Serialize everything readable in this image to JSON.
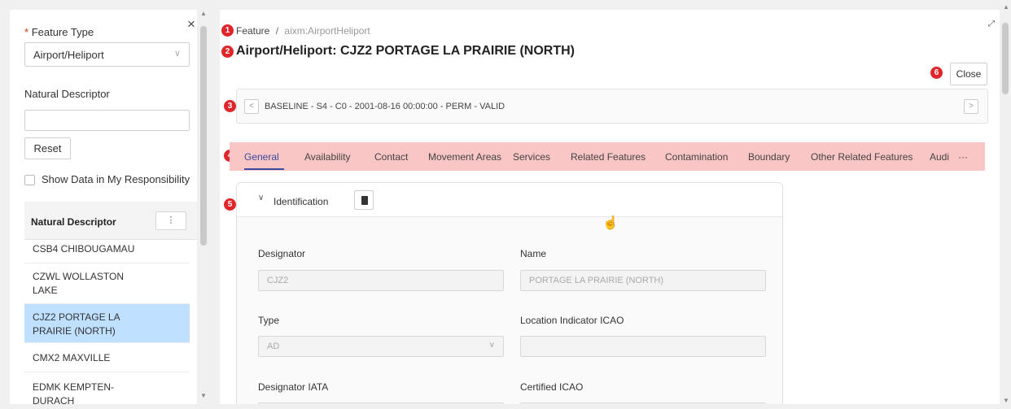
{
  "left": {
    "close_glyph": "×",
    "feature_type_label": "Feature Type",
    "required_mark": "*",
    "feature_type_value": "Airport/Heliport",
    "natural_descriptor_label": "Natural Descriptor",
    "natural_descriptor_value": "",
    "reset_label": "Reset",
    "show_data_label": "Show Data in My Responsibility",
    "list_header": "Natural Descriptor",
    "list_menu_glyph": "⋮",
    "items": [
      {
        "label_line1": "CSB4 CHIBOUGAMAU",
        "label_line2": ""
      },
      {
        "label_line1": "CZWL WOLLASTON",
        "label_line2": "LAKE"
      },
      {
        "label_line1": "CJZ2 PORTAGE LA",
        "label_line2": "PRAIRIE (NORTH)",
        "selected": true
      },
      {
        "label_line1": "CMX2 MAXVILLE",
        "label_line2": ""
      },
      {
        "label_line1": "EDMK KEMPTEN-",
        "label_line2": "DURACH"
      }
    ]
  },
  "main": {
    "badges": [
      "1",
      "2",
      "3",
      "4",
      "5",
      "6"
    ],
    "breadcrumb": {
      "root": "Feature",
      "separator": "/",
      "current": "aixm:AirportHeliport"
    },
    "title": "Airport/Heliport: CJZ2 PORTAGE LA PRAIRIE (NORTH)",
    "close_label": "Close",
    "version_text": "BASELINE - S4 - C0 - 2001-08-16 00:00:00 - PERM - VALID",
    "tabs": [
      "General",
      "Availability",
      "Contact",
      "Movement Areas",
      "Services",
      "Related Features",
      "Contamination",
      "Boundary",
      "Other Related Features",
      "Audi",
      "···"
    ],
    "section": {
      "title": "Identification",
      "fields": {
        "designator_label": "Designator",
        "designator_value": "CJZ2",
        "name_label": "Name",
        "name_value": "PORTAGE LA PRAIRIE (NORTH)",
        "type_label": "Type",
        "type_value": "AD",
        "location_indicator_label": "Location Indicator ICAO",
        "location_indicator_value": "",
        "designator_iata_label": "Designator IATA",
        "certified_icao_label": "Certified ICAO"
      }
    }
  },
  "colors": {
    "badge": "#e0262a",
    "tabs_highlight": "#f9c5c5",
    "selected_item": "#bfe0ff",
    "active_tab": "#3a4aa0"
  }
}
